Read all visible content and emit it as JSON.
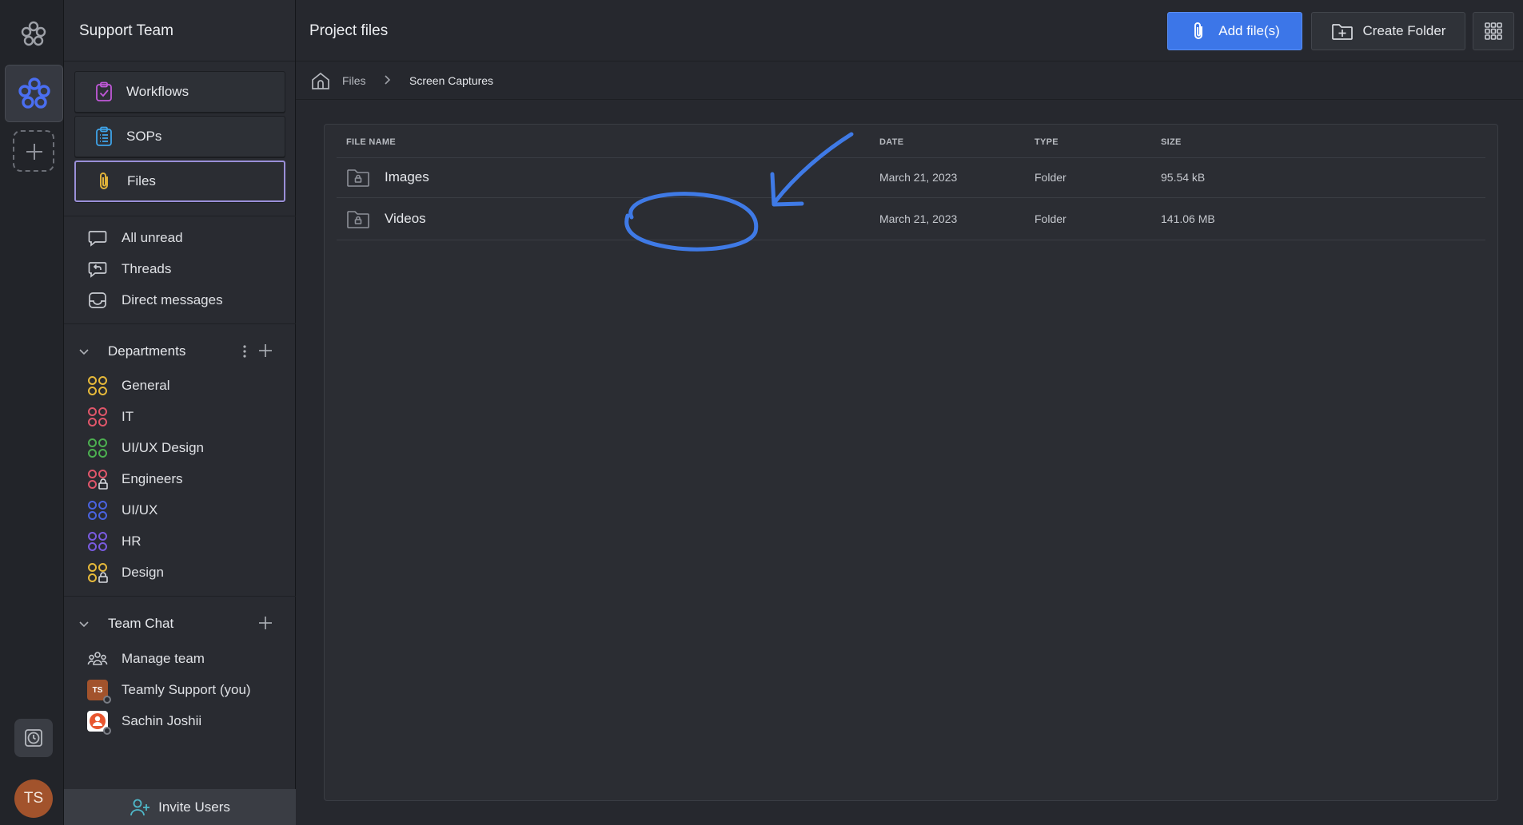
{
  "rail": {
    "avatar_initials": "TS"
  },
  "sidebar": {
    "team_name": "Support Team",
    "nav": [
      {
        "label": "Workflows",
        "icon": "clipboard-check-icon"
      },
      {
        "label": "SOPs",
        "icon": "list-clipboard-icon"
      },
      {
        "label": "Files",
        "icon": "paperclip-icon",
        "active": true
      }
    ],
    "quick": [
      {
        "label": "All unread",
        "icon": "chat-bubble-icon"
      },
      {
        "label": "Threads",
        "icon": "thread-reply-icon"
      },
      {
        "label": "Direct messages",
        "icon": "inbox-icon"
      }
    ],
    "departments": {
      "title": "Departments",
      "items": [
        {
          "label": "General",
          "color": "#e6b93a",
          "locked": false
        },
        {
          "label": "IT",
          "color": "#e0566a",
          "locked": false
        },
        {
          "label": "UI/UX Design",
          "color": "#4caf50",
          "locked": false
        },
        {
          "label": "Engineers",
          "color": "#e0566a",
          "locked": true
        },
        {
          "label": "UI/UX",
          "color": "#4a63e0",
          "locked": false
        },
        {
          "label": "HR",
          "color": "#7a5be0",
          "locked": false
        },
        {
          "label": "Design",
          "color": "#e6b93a",
          "locked": true
        }
      ]
    },
    "team_chat": {
      "title": "Team Chat",
      "items": [
        {
          "label": "Manage team",
          "icon": "people-group-icon"
        },
        {
          "label": "Teamly Support (you)",
          "avatar": "TS",
          "avatar_color": "#a2532c"
        },
        {
          "label": "Sachin Joshii",
          "avatar_color": "#ffffff"
        }
      ]
    },
    "invite_label": "Invite Users"
  },
  "main": {
    "title": "Project files",
    "add_files_label": "Add file(s)",
    "create_folder_label": "Create Folder",
    "breadcrumb": [
      "Files",
      "Screen Captures"
    ],
    "table": {
      "headers": {
        "name": "FILE NAME",
        "date": "DATE",
        "type": "TYPE",
        "size": "SIZE"
      },
      "rows": [
        {
          "name": "Images",
          "date": "March 21, 2023",
          "type": "Folder",
          "size": "95.54 kB"
        },
        {
          "name": "Videos",
          "date": "March 21, 2023",
          "type": "Folder",
          "size": "141.06 MB"
        }
      ]
    }
  },
  "colors": {
    "accent": "#3c76e8",
    "active_border": "#9a8fd8",
    "annotation": "#3f7ae6"
  }
}
